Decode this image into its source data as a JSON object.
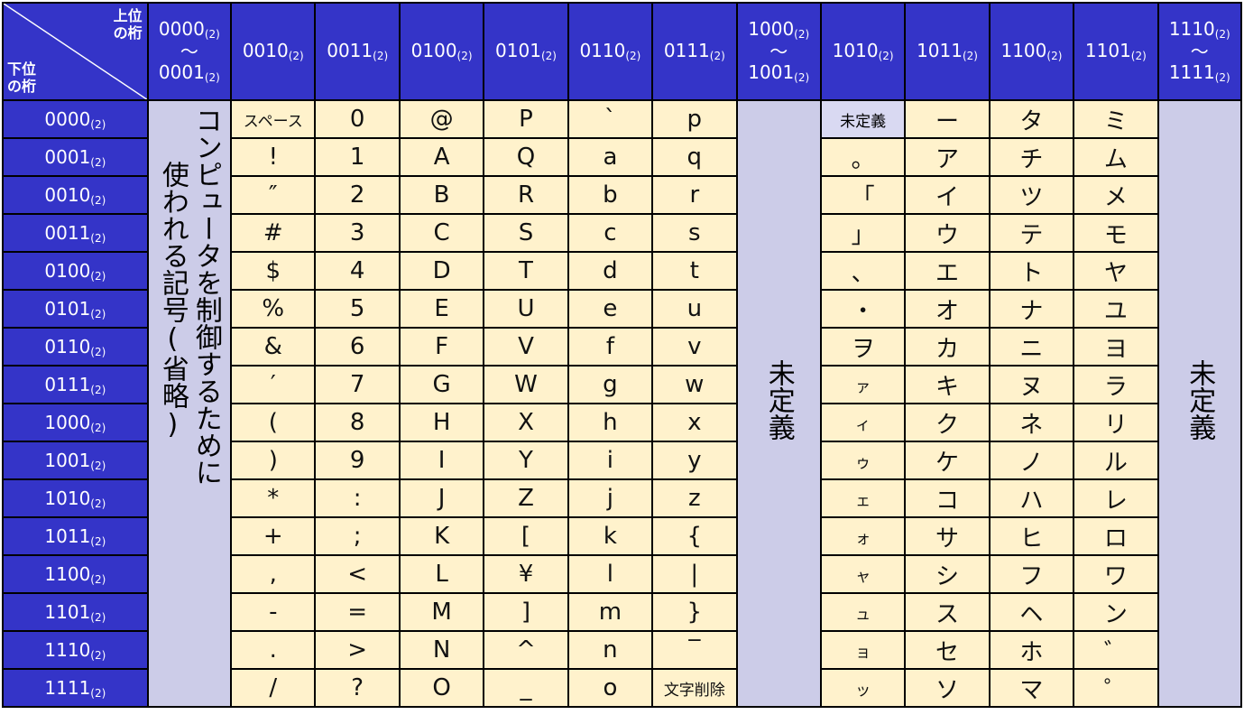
{
  "corner": {
    "upper": "上位\nの桁",
    "lower": "下位\nの桁"
  },
  "col_headers": [
    {
      "lines": [
        [
          "0000",
          "(2)"
        ],
        [
          "〜",
          ""
        ],
        [
          "0001",
          "(2)"
        ]
      ]
    },
    {
      "lines": [
        [
          "0010",
          "(2)"
        ]
      ]
    },
    {
      "lines": [
        [
          "0011",
          "(2)"
        ]
      ]
    },
    {
      "lines": [
        [
          "0100",
          "(2)"
        ]
      ]
    },
    {
      "lines": [
        [
          "0101",
          "(2)"
        ]
      ]
    },
    {
      "lines": [
        [
          "0110",
          "(2)"
        ]
      ]
    },
    {
      "lines": [
        [
          "0111",
          "(2)"
        ]
      ]
    },
    {
      "lines": [
        [
          "1000",
          "(2)"
        ],
        [
          "〜",
          ""
        ],
        [
          "1001",
          "(2)"
        ]
      ]
    },
    {
      "lines": [
        [
          "1010",
          "(2)"
        ]
      ]
    },
    {
      "lines": [
        [
          "1011",
          "(2)"
        ]
      ]
    },
    {
      "lines": [
        [
          "1100",
          "(2)"
        ]
      ]
    },
    {
      "lines": [
        [
          "1101",
          "(2)"
        ]
      ]
    },
    {
      "lines": [
        [
          "1110",
          "(2)"
        ],
        [
          "〜",
          ""
        ],
        [
          "1111",
          "(2)"
        ]
      ]
    }
  ],
  "row_headers": [
    {
      "main": "0000",
      "sub": "(2)"
    },
    {
      "main": "0001",
      "sub": "(2)"
    },
    {
      "main": "0010",
      "sub": "(2)"
    },
    {
      "main": "0011",
      "sub": "(2)"
    },
    {
      "main": "0100",
      "sub": "(2)"
    },
    {
      "main": "0101",
      "sub": "(2)"
    },
    {
      "main": "0110",
      "sub": "(2)"
    },
    {
      "main": "0111",
      "sub": "(2)"
    },
    {
      "main": "1000",
      "sub": "(2)"
    },
    {
      "main": "1001",
      "sub": "(2)"
    },
    {
      "main": "1010",
      "sub": "(2)"
    },
    {
      "main": "1011",
      "sub": "(2)"
    },
    {
      "main": "1100",
      "sub": "(2)"
    },
    {
      "main": "1101",
      "sub": "(2)"
    },
    {
      "main": "1110",
      "sub": "(2)"
    },
    {
      "main": "1111",
      "sub": "(2)"
    }
  ],
  "control_band": {
    "col1": "コンピュータを制御するために",
    "col2": "使われる記号(省略)"
  },
  "undefined_label": "未定義",
  "columns": {
    "c0010": [
      "スペース",
      "!",
      "″",
      "#",
      "$",
      "%",
      "&",
      "′",
      "(",
      ")",
      "*",
      "+",
      ",",
      "-",
      ".",
      "/"
    ],
    "c0011": [
      "0",
      "1",
      "2",
      "3",
      "4",
      "5",
      "6",
      "7",
      "8",
      "9",
      ":",
      ";",
      "<",
      "=",
      ">",
      "?"
    ],
    "c0100": [
      "@",
      "A",
      "B",
      "C",
      "D",
      "E",
      "F",
      "G",
      "H",
      "I",
      "J",
      "K",
      "L",
      "M",
      "N",
      "O"
    ],
    "c0101": [
      "P",
      "Q",
      "R",
      "S",
      "T",
      "U",
      "V",
      "W",
      "X",
      "Y",
      "Z",
      "[",
      "¥",
      "]",
      "^",
      "_"
    ],
    "c0110": [
      "`",
      "a",
      "b",
      "c",
      "d",
      "e",
      "f",
      "g",
      "h",
      "i",
      "j",
      "k",
      "l",
      "m",
      "n",
      "o"
    ],
    "c0111": [
      "p",
      "q",
      "r",
      "s",
      "t",
      "u",
      "v",
      "w",
      "x",
      "y",
      "z",
      "{",
      "|",
      "}",
      "‾",
      "文字削除"
    ],
    "c1010": [
      "未定義",
      "。",
      "「",
      "」",
      "、",
      "・",
      "ヲ",
      "ァ",
      "ィ",
      "ゥ",
      "ェ",
      "ォ",
      "ャ",
      "ュ",
      "ョ",
      "ッ"
    ],
    "c1011": [
      "ー",
      "ア",
      "イ",
      "ウ",
      "エ",
      "オ",
      "カ",
      "キ",
      "ク",
      "ケ",
      "コ",
      "サ",
      "シ",
      "ス",
      "セ",
      "ソ"
    ],
    "c1100": [
      "タ",
      "チ",
      "ツ",
      "テ",
      "ト",
      "ナ",
      "ニ",
      "ヌ",
      "ネ",
      "ノ",
      "ハ",
      "ヒ",
      "フ",
      "ヘ",
      "ホ",
      "マ"
    ],
    "c1101": [
      "ミ",
      "ム",
      "メ",
      "モ",
      "ヤ",
      "ユ",
      "ヨ",
      "ラ",
      "リ",
      "ル",
      "レ",
      "ロ",
      "ワ",
      "ン",
      "゛",
      "゜"
    ]
  },
  "colors": {
    "header_blue": "#3434c8",
    "cell_cream": "#fff2cc",
    "band_lavender": "#cccce8"
  }
}
